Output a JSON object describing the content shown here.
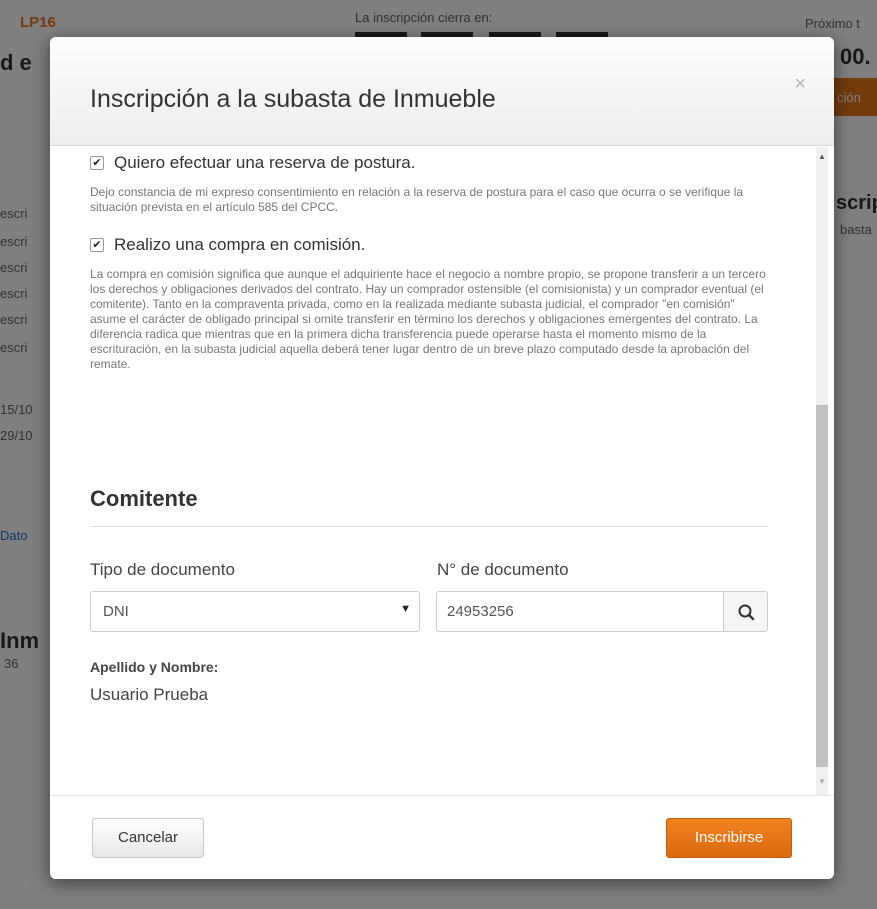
{
  "background": {
    "code": "LP16",
    "countdown_label": "La inscripción cierra en:",
    "next_label": "Próximo t",
    "amount_fragment": "00.",
    "title_fragment": "d e",
    "button_fragment": "ción",
    "right_title_fragment": "scrip",
    "right_sub_fragment": "basta",
    "left_row_fragment": "escri",
    "date1": "15/10",
    "date2": "29/10",
    "link_fragment": "Dato",
    "heading_fragment": "Inm",
    "icon_text": "36"
  },
  "modal": {
    "title": "Inscripción a la subasta de Inmueble",
    "close_symbol": "×",
    "reserve": {
      "checked": true,
      "label": "Quiero efectuar una reserva de postura.",
      "description": "Dejo constancia de mi expreso consentimiento en relación a la reserva de postura para el caso que ocurra o se verifique la situación prevista en el artículo 585 del CPCC."
    },
    "commission": {
      "checked": true,
      "label": "Realizo una compra en comisión.",
      "description": "La compra en comisión significa que aunque el adquiriente hace el negocio a nombre propio, se propone transferir a un tercero los derechos y obligaciones derivados del contrato. Hay un comprador ostensible (el comisionista) y un comprador eventual (el comitente). Tanto en la compraventa privada, como en la realizada mediante subasta judicial, el comprador \"en comisión\" asume el carácter de obligado principal si omite transferir en término los derechos y obligaciones emergentes del contrato. La diferencia radica que mientras que en la primera dicha transferencia puede operarse hasta el momento mismo de la escrituración, en la subasta judicial aquella deberá tener lugar dentro de un breve plazo computado desde la aprobación del remate."
    },
    "comitente": {
      "section_title": "Comitente",
      "doc_type_label": "Tipo de documento",
      "doc_type_value": "DNI",
      "doc_number_label": "N° de documento",
      "doc_number_value": "24953256",
      "name_label": "Apellido y Nombre:",
      "name_value": "Usuario Prueba"
    },
    "footer": {
      "cancel_label": "Cancelar",
      "submit_label": "Inscribirse"
    }
  },
  "colors": {
    "accent": "#e8761a",
    "overlay": "rgba(0,0,0,0.5)"
  },
  "icons": [
    "close-icon",
    "checkbox-checked-icon",
    "dropdown-caret-icon",
    "search-icon",
    "scroll-up-arrow-icon",
    "scroll-down-arrow-icon"
  ]
}
